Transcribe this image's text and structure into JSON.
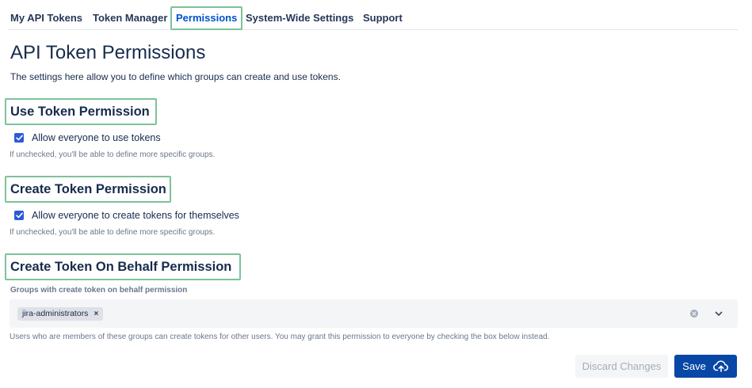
{
  "nav": {
    "tabs": [
      {
        "label": "My API Tokens",
        "active": false
      },
      {
        "label": "Token Manager",
        "active": false
      },
      {
        "label": "Permissions",
        "active": true
      },
      {
        "label": "System-Wide Settings",
        "active": false
      },
      {
        "label": "Support",
        "active": false
      }
    ]
  },
  "page": {
    "title": "API Token Permissions",
    "intro": "The settings here allow you to define which groups can create and use tokens."
  },
  "use_token": {
    "title": "Use Token Permission",
    "checkbox_label": "Allow everyone to use tokens",
    "checked": true,
    "helper": "If unchecked, you'll be able to define more specific groups."
  },
  "create_token": {
    "title": "Create Token Permission",
    "checkbox_label": "Allow everyone to create tokens for themselves",
    "checked": true,
    "helper": "If unchecked, you'll be able to define more specific groups."
  },
  "behalf": {
    "title": "Create Token On Behalf Permission",
    "field_label": "Groups with create token on behalf permission",
    "selected_groups": [
      "jira-administrators"
    ],
    "remove_glyph": "×",
    "helper": "Users who are members of these groups can create tokens for other users. You may grant this permission to everyone by checking the box below instead."
  },
  "actions": {
    "discard_label": "Discard Changes",
    "save_label": "Save"
  },
  "icons": {
    "checkbox": "checkmark-icon",
    "clear": "clear-icon",
    "dropdown": "chevron-down-icon",
    "save": "cloud-upload-icon"
  },
  "colors": {
    "accent": "#0052cc",
    "primary_button": "#0747a6",
    "highlight_outline": "#7cc39a",
    "checkbox": "#2d5bd5"
  }
}
